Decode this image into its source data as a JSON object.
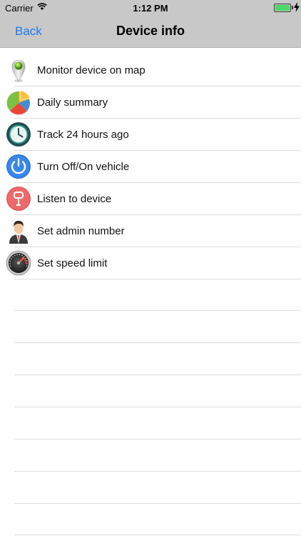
{
  "status_bar": {
    "carrier": "Carrier",
    "time": "1:12 PM",
    "battery_level": 1.0,
    "battery_color": "#4cd964"
  },
  "nav_bar": {
    "back_label": "Back",
    "title": "Device info",
    "accent_color": "#1a7cf0"
  },
  "menu": {
    "items": [
      {
        "label": "Monitor device on map",
        "icon": "map-pin-icon"
      },
      {
        "label": "Daily summary",
        "icon": "pie-chart-icon"
      },
      {
        "label": "Track 24 hours ago",
        "icon": "history-clock-icon"
      },
      {
        "label": "Turn Off/On vehicle",
        "icon": "power-icon"
      },
      {
        "label": "Listen to device",
        "icon": "microphone-icon"
      },
      {
        "label": "Set admin number",
        "icon": "admin-user-icon"
      },
      {
        "label": "Set speed limit",
        "icon": "speedometer-icon"
      }
    ]
  }
}
